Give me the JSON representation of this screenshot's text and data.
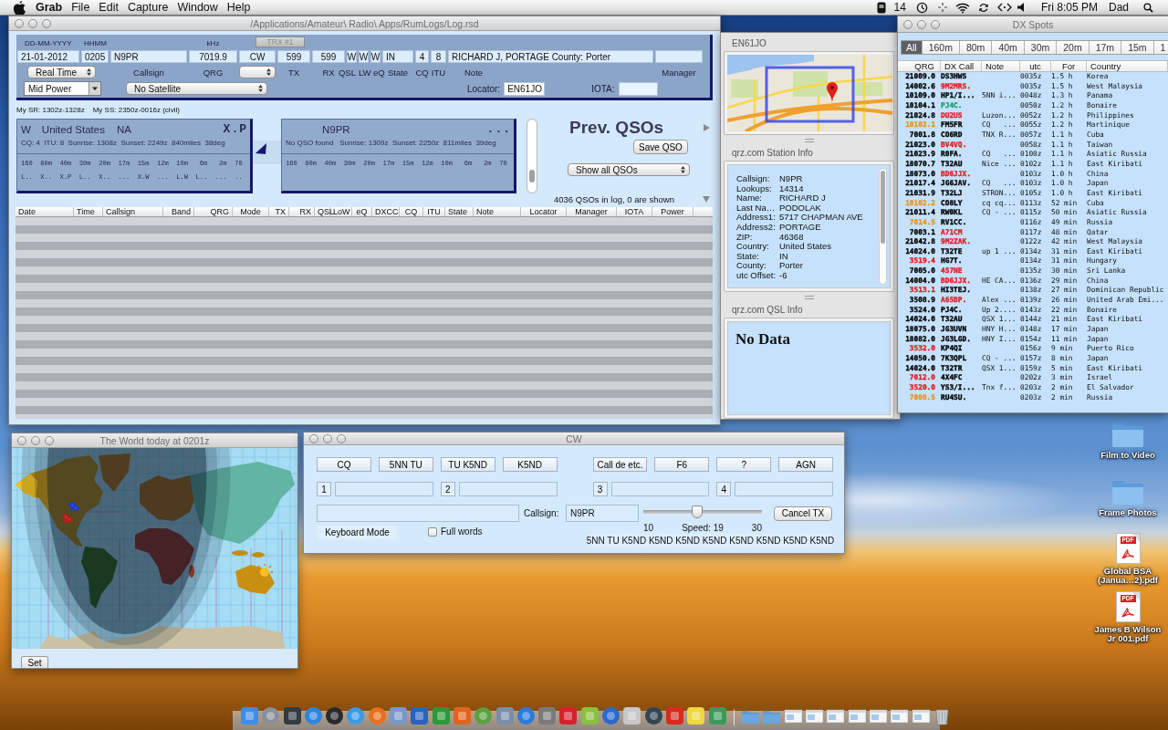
{
  "menu_bar": {
    "app": "Grab",
    "menus": [
      "File",
      "Edit",
      "Capture",
      "Window",
      "Help"
    ],
    "badge": "14",
    "clock": "Fri 8:05 PM",
    "user": "Dad"
  },
  "log_window": {
    "title": "/Applications/Amateur\\ Radio\\ Apps/RumLogs/Log.rsd",
    "hints": [
      "DD-MM-YYYY",
      "HHMM",
      "kHz"
    ],
    "trx_button": "TRX #1",
    "fields": [
      "21-01-2012",
      "0205",
      "N9PR",
      "7019.9",
      "CW",
      "599",
      "599",
      "W",
      "W",
      "W",
      "IN",
      "4",
      "8",
      "RICHARD J, PORTAGE  County: Porter"
    ],
    "time_mode": "Real Time",
    "labels": [
      "Callsign",
      "QRG",
      "TX",
      "RX",
      "QSL",
      "LW",
      "eQ",
      "State",
      "CQ",
      "ITU",
      "Note",
      "Manager"
    ],
    "power": "Mid Power",
    "satellite": "No Satellite",
    "locator_label": "Locator:",
    "locator": "EN61JO",
    "iota_label": "IOTA:",
    "sun_times": [
      "My SR: 1302z-1328z",
      "My SS: 2350z-0016z (civil)"
    ],
    "dx_card": {
      "prefix": "W",
      "country": "United States",
      "continent": "NA",
      "status": "X.P",
      "details": "CQ: 4  ITU: 8  Sunrise: 1308z  Sunset: 2249z  840miles  38deg",
      "bands": "160  80m  40m  30m  20m  17m  15m  12m  10m   6m   2m  70",
      "band_status": "L..  X..  X.P  L..  X..  ...  X.W  ...  L.W  L..  ...  .."
    },
    "call_card": {
      "callsign": "N9PR",
      "status": "...",
      "details": "No QSO found   Sunrise: 1309z  Sunset: 2250z  811miles  39deg",
      "bands": "160  80m  40m  30m  20m  17m  15m  12m  10m   6m   2m  70"
    },
    "prev_title": "Prev. QSOs",
    "save_button": "Save QSO",
    "filter": "Show all QSOs",
    "count": "4036 QSOs in log, 0 are shown",
    "table": {
      "columns": [
        "Date",
        "Time",
        "Callsign",
        "Band",
        "QRG",
        "Mode",
        "TX",
        "RX",
        "QSL",
        "LoW",
        "eQ",
        "DXCC",
        "CQ",
        "ITU",
        "State",
        "Note",
        "Locator",
        "Manager",
        "IOTA",
        "Power"
      ]
    }
  },
  "locator_panel": {
    "title": "EN61JO",
    "station_title": "qrz.com Station Info",
    "station": [
      {
        "label": "Callsign:",
        "value": "N9PR"
      },
      {
        "label": "Lookups:",
        "value": "14314"
      },
      {
        "label": "Name:",
        "value": "RICHARD J"
      },
      {
        "label": "Last Na…",
        "value": "PODOLAK"
      },
      {
        "label": "Address1:",
        "value": "5717 CHAPMAN AVE"
      },
      {
        "label": "Address2:",
        "value": "PORTAGE"
      },
      {
        "label": "ZIP:",
        "value": "46368"
      },
      {
        "label": "Country:",
        "value": "United States"
      },
      {
        "label": "State:",
        "value": "IN"
      },
      {
        "label": "County:",
        "value": "Porter"
      },
      {
        "label": "utc Offset:",
        "value": "-6"
      }
    ],
    "qsl_title": "qrz.com QSL Info",
    "qsl_text": "No Data"
  },
  "dx_spots": {
    "title": "DX Spots",
    "tabs": [
      {
        "label": "All",
        "selected": true
      },
      {
        "label": "160m",
        "selected": false
      },
      {
        "label": "80m",
        "selected": false
      },
      {
        "label": "40m",
        "selected": false
      },
      {
        "label": "30m",
        "selected": false
      },
      {
        "label": "20m",
        "selected": false
      },
      {
        "label": "17m",
        "selected": false
      },
      {
        "label": "15m",
        "selected": false
      },
      {
        "label": "1",
        "selected": false
      }
    ],
    "columns": [
      "QRG",
      "DX Call",
      "Note",
      "utc",
      "For",
      "Country"
    ],
    "rows": [
      {
        "qrg": {
          "text": "21009.0",
          "color": "#000000"
        },
        "call": {
          "text": "DS3HWS",
          "color": "#000000"
        },
        "utc": "0035z",
        "for": "1.5 h",
        "country": "Korea"
      },
      {
        "qrg": {
          "text": "14002.6",
          "color": "#000000"
        },
        "call": {
          "text": "9M2MRS.",
          "color": "#e02020"
        },
        "utc": "0035z",
        "for": "1.5 h",
        "country": "West Malaysia"
      },
      {
        "qrg": {
          "text": "10109.0",
          "color": "#000000"
        },
        "call": {
          "text": "HP1/I...",
          "color": "#000000"
        },
        "note": "5NN i...",
        "utc": "0048z",
        "for": "1.3 h",
        "country": "Panama"
      },
      {
        "qrg": {
          "text": "10104.1",
          "color": "#000000"
        },
        "call": {
          "text": "PJ4C.",
          "color": "#18a070"
        },
        "utc": "0050z",
        "for": "1.2 h",
        "country": "Bonaire"
      },
      {
        "qrg": {
          "text": "21024.8",
          "color": "#000000"
        },
        "call": {
          "text": "DU2US",
          "color": "#e02020"
        },
        "note": "Luzon...",
        "utc": "0052z",
        "for": "1.2 h",
        "country": "Philippines"
      },
      {
        "qrg": {
          "text": "10102.1",
          "color": "#e89418"
        },
        "call": {
          "text": "FM5FR",
          "color": "#000000"
        },
        "note": "CQ   ...",
        "utc": "0055z",
        "for": "1.2 h",
        "country": "Martinique"
      },
      {
        "qrg": {
          "text": "7001.8",
          "color": "#000000"
        },
        "call": {
          "text": "CO6RD",
          "color": "#000000"
        },
        "note": "TNX R...",
        "utc": "0057z",
        "for": "1.1 h",
        "country": "Cuba"
      },
      {
        "qrg": {
          "text": "21023.0",
          "color": "#000000"
        },
        "call": {
          "text": "BV4VQ.",
          "color": "#e02020"
        },
        "utc": "0058z",
        "for": "1.1 h",
        "country": "Taiwan"
      },
      {
        "qrg": {
          "text": "21023.9",
          "color": "#000000"
        },
        "call": {
          "text": "R0FA.",
          "color": "#000000"
        },
        "note": "CQ   ...",
        "utc": "0100z",
        "for": "1.1 h",
        "country": "Asiatic Russia"
      },
      {
        "qrg": {
          "text": "18070.7",
          "color": "#000000"
        },
        "call": {
          "text": "T32AU",
          "color": "#000000"
        },
        "note": "Nice ...",
        "utc": "0102z",
        "for": "1.1 h",
        "country": "East Kiribati"
      },
      {
        "qrg": {
          "text": "18073.0",
          "color": "#000000"
        },
        "call": {
          "text": "BD6JJX.",
          "color": "#e02020"
        },
        "utc": "0103z",
        "for": "1.0 h",
        "country": "China"
      },
      {
        "qrg": {
          "text": "21017.4",
          "color": "#000000"
        },
        "call": {
          "text": "JG6JAV.",
          "color": "#000000"
        },
        "note": "CQ   ...",
        "utc": "0103z",
        "for": "1.0 h",
        "country": "Japan"
      },
      {
        "qrg": {
          "text": "21031.9",
          "color": "#000000"
        },
        "call": {
          "text": "T32LJ",
          "color": "#000000"
        },
        "note": "STRON...",
        "utc": "0105z",
        "for": "1.0 h",
        "country": "East Kiribati"
      },
      {
        "qrg": {
          "text": "10102.2",
          "color": "#e89418"
        },
        "call": {
          "text": "CO8LY",
          "color": "#000000"
        },
        "note": "cq cq...",
        "utc": "0113z",
        "for": "52 min",
        "country": "Cuba"
      },
      {
        "qrg": {
          "text": "21011.4",
          "color": "#000000"
        },
        "call": {
          "text": "RW0KL",
          "color": "#000000"
        },
        "note": "CQ - ...",
        "utc": "0115z",
        "for": "50 min",
        "country": "Asiatic Russia"
      },
      {
        "qrg": {
          "text": "7014.5",
          "color": "#e89418"
        },
        "call": {
          "text": "RV1CC.",
          "color": "#000000"
        },
        "utc": "0116z",
        "for": "49 min",
        "country": "Russia"
      },
      {
        "qrg": {
          "text": "7003.1",
          "color": "#000000"
        },
        "call": {
          "text": "A71CM",
          "color": "#e02020"
        },
        "utc": "0117z",
        "for": "48 min",
        "country": "Qatar"
      },
      {
        "qrg": {
          "text": "21042.8",
          "color": "#000000"
        },
        "call": {
          "text": "9M2ZAK.",
          "color": "#e02020"
        },
        "utc": "0122z",
        "for": "42 min",
        "country": "West Malaysia"
      },
      {
        "qrg": {
          "text": "14024.0",
          "color": "#000000"
        },
        "call": {
          "text": "T32TE",
          "color": "#000000"
        },
        "note": "up 1 ...",
        "utc": "0134z",
        "for": "31 min",
        "country": "East Kiribati"
      },
      {
        "qrg": {
          "text": "3519.4",
          "color": "#e02020"
        },
        "call": {
          "text": "HG7T.",
          "color": "#000000"
        },
        "utc": "0134z",
        "for": "31 min",
        "country": "Hungary"
      },
      {
        "qrg": {
          "text": "7005.0",
          "color": "#000000"
        },
        "call": {
          "text": "4S7NE",
          "color": "#e02020"
        },
        "utc": "0135z",
        "for": "30 min",
        "country": "Sri Lanka"
      },
      {
        "qrg": {
          "text": "14004.0",
          "color": "#000000"
        },
        "call": {
          "text": "BD6JJX.",
          "color": "#e02020"
        },
        "note": "HE CA...",
        "utc": "0136z",
        "for": "29 min",
        "country": "China"
      },
      {
        "qrg": {
          "text": "3513.1",
          "color": "#e02020"
        },
        "call": {
          "text": "HI3TEJ.",
          "color": "#000000"
        },
        "utc": "0138z",
        "for": "27 min",
        "country": "Dominican Republic"
      },
      {
        "qrg": {
          "text": "3508.9",
          "color": "#000000"
        },
        "call": {
          "text": "A65BP.",
          "color": "#e02020"
        },
        "note": "Alex ...",
        "utc": "0139z",
        "for": "26 min",
        "country": "United Arab Emi..."
      },
      {
        "qrg": {
          "text": "3524.0",
          "color": "#000000"
        },
        "call": {
          "text": "PJ4C.",
          "color": "#000000"
        },
        "note": "Up 2....",
        "utc": "0143z",
        "for": "22 min",
        "country": "Bonaire"
      },
      {
        "qrg": {
          "text": "14024.0",
          "color": "#000000"
        },
        "call": {
          "text": "T32AU",
          "color": "#000000"
        },
        "note": "QSX 1...",
        "utc": "0144z",
        "for": "21 min",
        "country": "East Kiribati"
      },
      {
        "qrg": {
          "text": "18075.0",
          "color": "#000000"
        },
        "call": {
          "text": "JG3UVN",
          "color": "#000000"
        },
        "note": "HNY H...",
        "utc": "0148z",
        "for": "17 min",
        "country": "Japan"
      },
      {
        "qrg": {
          "text": "18082.0",
          "color": "#000000"
        },
        "call": {
          "text": "JG3LGD.",
          "color": "#000000"
        },
        "note": "HNY I...",
        "utc": "0154z",
        "for": "11 min",
        "country": "Japan"
      },
      {
        "qrg": {
          "text": "3532.0",
          "color": "#e02020"
        },
        "call": {
          "text": "KP4QI",
          "color": "#000000"
        },
        "utc": "0156z",
        "for": "9 min",
        "country": "Puerto Rico"
      },
      {
        "qrg": {
          "text": "14050.0",
          "color": "#000000"
        },
        "call": {
          "text": "7K3QPL",
          "color": "#000000"
        },
        "note": "CQ - ...",
        "utc": "0157z",
        "for": "8 min",
        "country": "Japan"
      },
      {
        "qrg": {
          "text": "14024.0",
          "color": "#000000"
        },
        "call": {
          "text": "T32TR",
          "color": "#000000"
        },
        "note": "QSX 1...",
        "utc": "0159z",
        "for": "5 min",
        "country": "East Kiribati"
      },
      {
        "qrg": {
          "text": "7012.0",
          "color": "#e02020"
        },
        "call": {
          "text": "4X4FC",
          "color": "#000000"
        },
        "utc": "0202z",
        "for": "3 min",
        "country": "Israel"
      },
      {
        "qrg": {
          "text": "3520.0",
          "color": "#e02020"
        },
        "call": {
          "text": "YS3/I...",
          "color": "#000000"
        },
        "note": "Tnx f...",
        "utc": "0203z",
        "for": "2 min",
        "country": "El Salvador"
      },
      {
        "qrg": {
          "text": "7008.5",
          "color": "#e89418"
        },
        "call": {
          "text": "RU4SU.",
          "color": "#000000"
        },
        "utc": "0203z",
        "for": "2 min",
        "country": "Russia"
      }
    ]
  },
  "world_window": {
    "title": "The World today at 0201z",
    "set_button": "Set"
  },
  "cw_window": {
    "title": "CW",
    "macros": [
      "CQ",
      "5NN TU",
      "TU K5ND",
      "K5ND",
      "Call de etc.",
      "F6",
      "?",
      "AGN"
    ],
    "memory_slots": [
      "1",
      "2",
      "3",
      "4"
    ],
    "callsign_label": "Callsign:",
    "callsign": "N9PR",
    "speed": {
      "level": 0.45,
      "min": "10",
      "label": "Speed: 19",
      "max": "30"
    },
    "cancel_button": "Cancel TX",
    "keyboard_mode": "Keyboard Mode",
    "full_words": {
      "label": "Full words",
      "checked": false
    },
    "sent_text": "5NN TU K5ND K5ND K5ND K5ND K5ND K5ND K5ND K5ND"
  },
  "desktop_icons": [
    {
      "kind": "folder",
      "label": "Film to Video"
    },
    {
      "kind": "folder",
      "label": "Frame Photos"
    },
    {
      "kind": "pdf",
      "badge": "PDF",
      "label": "Global BSA (Janua…2).pdf"
    },
    {
      "kind": "pdf",
      "badge": "PDF",
      "label": "James B Wilson Jr 001.pdf"
    }
  ]
}
